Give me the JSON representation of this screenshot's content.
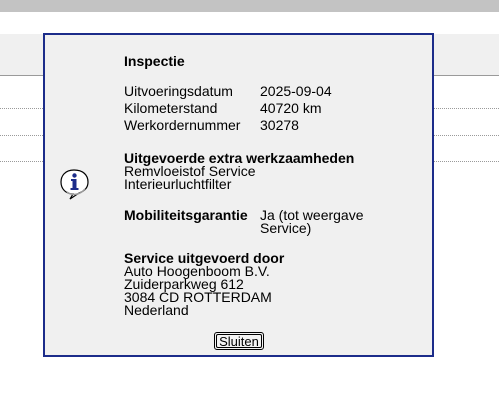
{
  "dialog": {
    "title": "Inspectie",
    "fields": [
      {
        "label": "Uitvoeringsdatum",
        "value": "2025-09-04"
      },
      {
        "label": "Kilometerstand",
        "value": "40720 km"
      },
      {
        "label": "Werkordernummer",
        "value": "30278"
      }
    ],
    "extra_work": {
      "title": "Uitgevoerde extra werkzaamheden",
      "items": [
        "Remvloeistof Service",
        "Interieurluchtfilter"
      ]
    },
    "mobility": {
      "label": "Mobiliteitsgarantie",
      "value_line1": "Ja (tot weergave",
      "value_line2": "Service)"
    },
    "service_by": {
      "title": "Service uitgevoerd door",
      "lines": [
        "Auto Hoogenboom B.V.",
        "Zuiderparkweg 612",
        "3084 CD ROTTERDAM",
        "Nederland"
      ]
    },
    "close_label": "Sluiten",
    "icon": "info-icon"
  }
}
